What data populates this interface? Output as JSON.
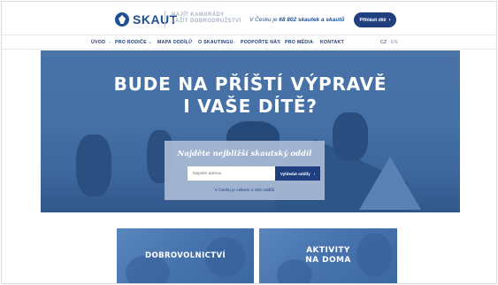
{
  "header": {
    "logo_text": "SKAUT",
    "slogan_line1": "NAJÍT KAMARÁDY",
    "slogan_line2": "ZAŽÍT DOBRODRUŽSTVÍ",
    "tagline_prefix": "V Česku je",
    "tagline_count": "68 802",
    "tagline_bold": "skautek a skautů",
    "cta_label": "Přihlásit dítě"
  },
  "nav": {
    "items": [
      {
        "label": "ÚVOD"
      },
      {
        "label": "PRO RODIČE ⌄"
      },
      {
        "label": "MAPA ODDÍLŮ"
      },
      {
        "label": "O SKAUTINGU"
      },
      {
        "label": "PODPOŘTE NÁS"
      },
      {
        "label": "PRO MÉDIA"
      },
      {
        "label": "KONTAKT"
      }
    ],
    "lang_cz": "CZ",
    "lang_en": "EN"
  },
  "hero": {
    "title_line1": "BUDE NA PŘÍŠTÍ VÝPRAVĚ",
    "title_line2": "I VAŠE DÍTĚ?",
    "finder_title": "Najděte nejbližší skautský oddíl",
    "search_placeholder": "Napište adresu",
    "search_button": "Vyhledat oddíly",
    "count_text": "V Česku je celkem 2 200 oddílů"
  },
  "cards": [
    {
      "label": "DOBROVOLNICTVÍ"
    },
    {
      "label_line1": "AKTIVITY",
      "label_line2": "NA DOMA"
    }
  ],
  "colors": {
    "brand": "#1f3f7e",
    "hero_blue": "#3f689e",
    "card_blue": "#4c78b4"
  }
}
